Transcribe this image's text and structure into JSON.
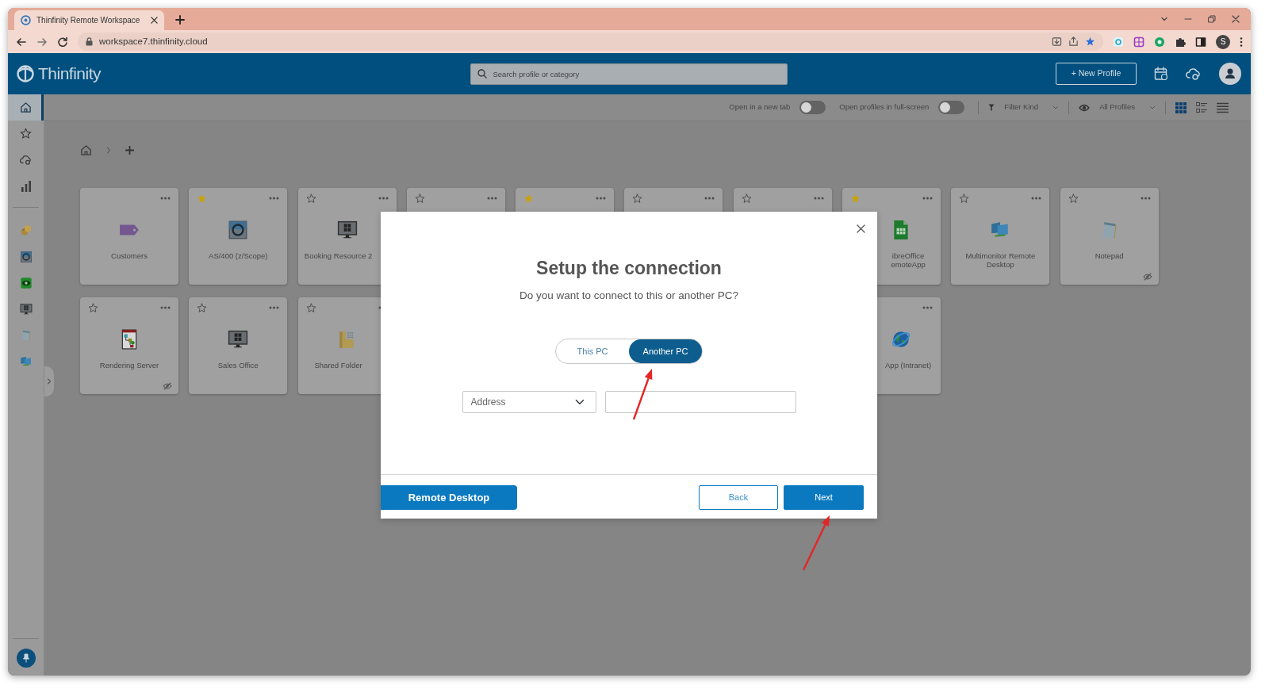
{
  "browser": {
    "tab_title": "Thinfinity Remote Workspace",
    "address": "workspace7.thinfinity.cloud",
    "profile_initial": "S"
  },
  "header": {
    "logo": "Thinfinity",
    "search": {
      "placeholder": "Search profile or category"
    },
    "new_profile_button": "+ New Profile"
  },
  "sidebar": {
    "nav": [
      {
        "kind": "home",
        "selected": true
      },
      {
        "kind": "favorites",
        "selected": false
      },
      {
        "kind": "cloud",
        "selected": false
      },
      {
        "kind": "stats",
        "selected": false
      }
    ],
    "apps": [
      {
        "kind": "boxes"
      },
      {
        "kind": "zscope"
      },
      {
        "kind": "viewer"
      },
      {
        "kind": "desktop"
      },
      {
        "kind": "notepad"
      },
      {
        "kind": "multimonitor"
      }
    ]
  },
  "toolbar": {
    "toggles": [
      {
        "label": "Open in a new tab",
        "on": false
      },
      {
        "label": "Open profiles in full-screen",
        "on": false
      }
    ],
    "filters": [
      {
        "kind": "filter",
        "label": "Filter Kind"
      },
      {
        "kind": "visibility",
        "label": "All Profiles"
      }
    ],
    "views": [
      {
        "kind": "grid",
        "selected": true
      },
      {
        "kind": "cards",
        "selected": false
      },
      {
        "kind": "list",
        "selected": false
      }
    ]
  },
  "tiles": [
    [
      {
        "label": "Customers",
        "kind": "tag",
        "hidden": false
      },
      {
        "label": "AS/400 (z/Scope)",
        "kind": "zscope",
        "starred": true,
        "hidden": false
      },
      {
        "label": "Booking Resource 2",
        "kind": "desktop",
        "starred": false,
        "hidden": false
      },
      {
        "starred": false
      },
      {
        "starred": true
      },
      {
        "starred": false
      },
      {
        "starred": false
      },
      {
        "label": "ibreOffice\nemoteApp",
        "kind": "spreadsheet",
        "starred": true,
        "hidden": false
      },
      {
        "label": "Multimonitor Remote Desktop",
        "kind": "multimonitor",
        "starred": false,
        "hidden": false
      },
      {
        "label": "Notepad",
        "kind": "notepad",
        "starred": false,
        "hidden": true
      }
    ],
    [
      {
        "label": "Rendering Server",
        "kind": "diagram",
        "starred": false,
        "hidden": true
      },
      {
        "label": "Sales Office",
        "kind": "desktop",
        "starred": false,
        "hidden": false
      },
      {
        "label": "Shared Folder",
        "kind": "folder",
        "starred": false,
        "hidden": false
      },
      {
        "label": "App (Intranet)",
        "kind": "globe",
        "hidden": false
      }
    ]
  ],
  "dialog": {
    "title": "Setup the connection",
    "subtitle": "Do you want to connect to this or another PC?",
    "options": [
      {
        "label": "This PC",
        "selected": false
      },
      {
        "label": "Another PC",
        "selected": true
      }
    ],
    "address_type": "Address",
    "buttons": [
      {
        "kind": "side",
        "label": "Remote Desktop"
      },
      {
        "kind": "secondary",
        "label": "Back"
      },
      {
        "kind": "primary",
        "label": "Next"
      }
    ]
  }
}
